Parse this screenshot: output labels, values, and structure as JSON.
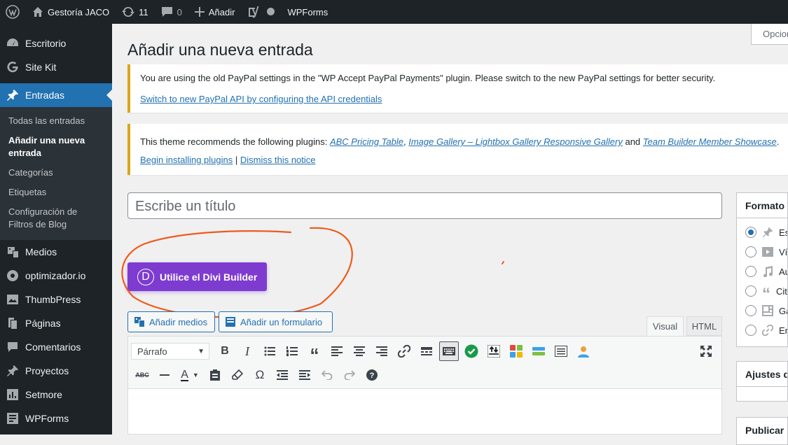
{
  "adminbar": {
    "site_name": "Gestoría JACO",
    "updates_count": "11",
    "comments_count": "0",
    "add_label": "Añadir",
    "wpforms_label": "WPForms"
  },
  "sidebar": {
    "items": [
      {
        "label": "Escritorio",
        "icon": "dashboard-icon"
      },
      {
        "label": "Site Kit",
        "icon": "google-g-icon"
      },
      {
        "label": "Entradas",
        "icon": "pin-icon"
      },
      {
        "label": "Medios",
        "icon": "media-icon"
      },
      {
        "label": "optimizador.io",
        "icon": "gauge-icon"
      },
      {
        "label": "ThumbPress",
        "icon": "image-icon"
      },
      {
        "label": "Páginas",
        "icon": "pages-icon"
      },
      {
        "label": "Comentarios",
        "icon": "comment-icon"
      },
      {
        "label": "Proyectos",
        "icon": "pin-icon"
      },
      {
        "label": "Setmore",
        "icon": "chart-icon"
      },
      {
        "label": "WPForms",
        "icon": "form-icon"
      }
    ],
    "submenu": [
      "Todas las entradas",
      "Añadir una nueva entrada",
      "Categorías",
      "Etiquetas",
      "Configuración de Filtros de Blog"
    ]
  },
  "screen_options_label": "Opciones",
  "page_title": "Añadir una nueva entrada",
  "notice_paypal": {
    "text": "You are using the old PayPal settings in the \"WP Accept PayPal Payments\" plugin. Please switch to the new PayPal settings for better security.",
    "link": "Switch to new PayPal API by configuring the API credentials"
  },
  "notice_theme": {
    "prefix": "This theme recommends the following plugins: ",
    "plugin1": "ABC Pricing Table",
    "sep1": ", ",
    "plugin2": "Image Gallery – Lightbox Gallery Responsive Gallery",
    "sep2": " and ",
    "plugin3": "Team Builder Member Showcase",
    "suffix": ".",
    "install_link": "Begin installing plugins",
    "divider": " | ",
    "dismiss_link": "Dismiss this notice"
  },
  "title_placeholder": "Escribe un título",
  "divi_button": {
    "letter": "D",
    "label": "Utilice el Divi Builder"
  },
  "media_buttons": {
    "add_media": "Añadir medios",
    "add_form": "Añadir un formulario"
  },
  "editor_tabs": {
    "visual": "Visual",
    "html": "HTML"
  },
  "toolbar": {
    "format_select": "Párrafo"
  },
  "side": {
    "format_title": "Formato",
    "format_options": [
      "Estándar",
      "Vídeo",
      "Audio",
      "Cita",
      "Galería",
      "Enlace"
    ],
    "ajustes_title": "Ajustes de Divi",
    "publicar_title": "Publicar"
  },
  "colors": {
    "accent": "#2271b1",
    "divi": "#7e3bd0",
    "notice_warning": "#dba617",
    "annotation": "#f05a1a"
  }
}
